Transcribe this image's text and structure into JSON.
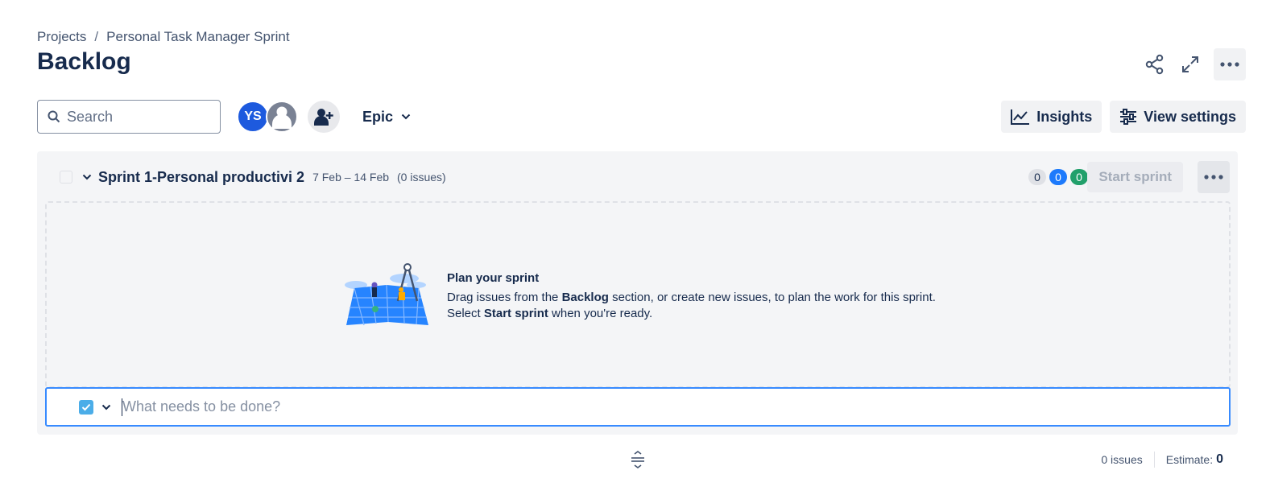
{
  "breadcrumb": {
    "items": [
      "Projects",
      "Personal Task Manager Sprint"
    ],
    "separator": "/"
  },
  "page": {
    "title": "Backlog"
  },
  "header_actions": {
    "icons": [
      "share-icon",
      "expand-icon",
      "more-icon"
    ]
  },
  "toolbar": {
    "search_placeholder": "Search",
    "avatars": [
      {
        "initials": "YS",
        "color": "#1d5ade"
      },
      {
        "initials": "",
        "color": "#7a8294"
      }
    ],
    "epic_label": "Epic",
    "insights_label": "Insights",
    "view_settings_label": "View settings"
  },
  "sprint": {
    "name": "Sprint 1-Personal productivi 2",
    "dates": "7 Feb – 14 Feb",
    "issue_count": "(0 issues)",
    "status_counts": {
      "todo": "0",
      "in_progress": "0",
      "done": "0"
    },
    "start_label": "Start sprint",
    "empty_title": "Plan your sprint",
    "empty_line1_pre": "Drag issues from the ",
    "empty_line1_bold": "Backlog",
    "empty_line1_post": " section, or create new issues, to plan the work for this sprint.",
    "empty_line2_pre": "Select ",
    "empty_line2_bold": "Start sprint",
    "empty_line2_post": " when you're ready.",
    "create_placeholder": "What needs to be done?"
  },
  "footer": {
    "issues": "0 issues",
    "estimate_label": "Estimate:",
    "estimate_value": "0"
  },
  "colors": {
    "accent": "#388bff",
    "in_progress": "#1d7afc",
    "done": "#22a06b"
  }
}
